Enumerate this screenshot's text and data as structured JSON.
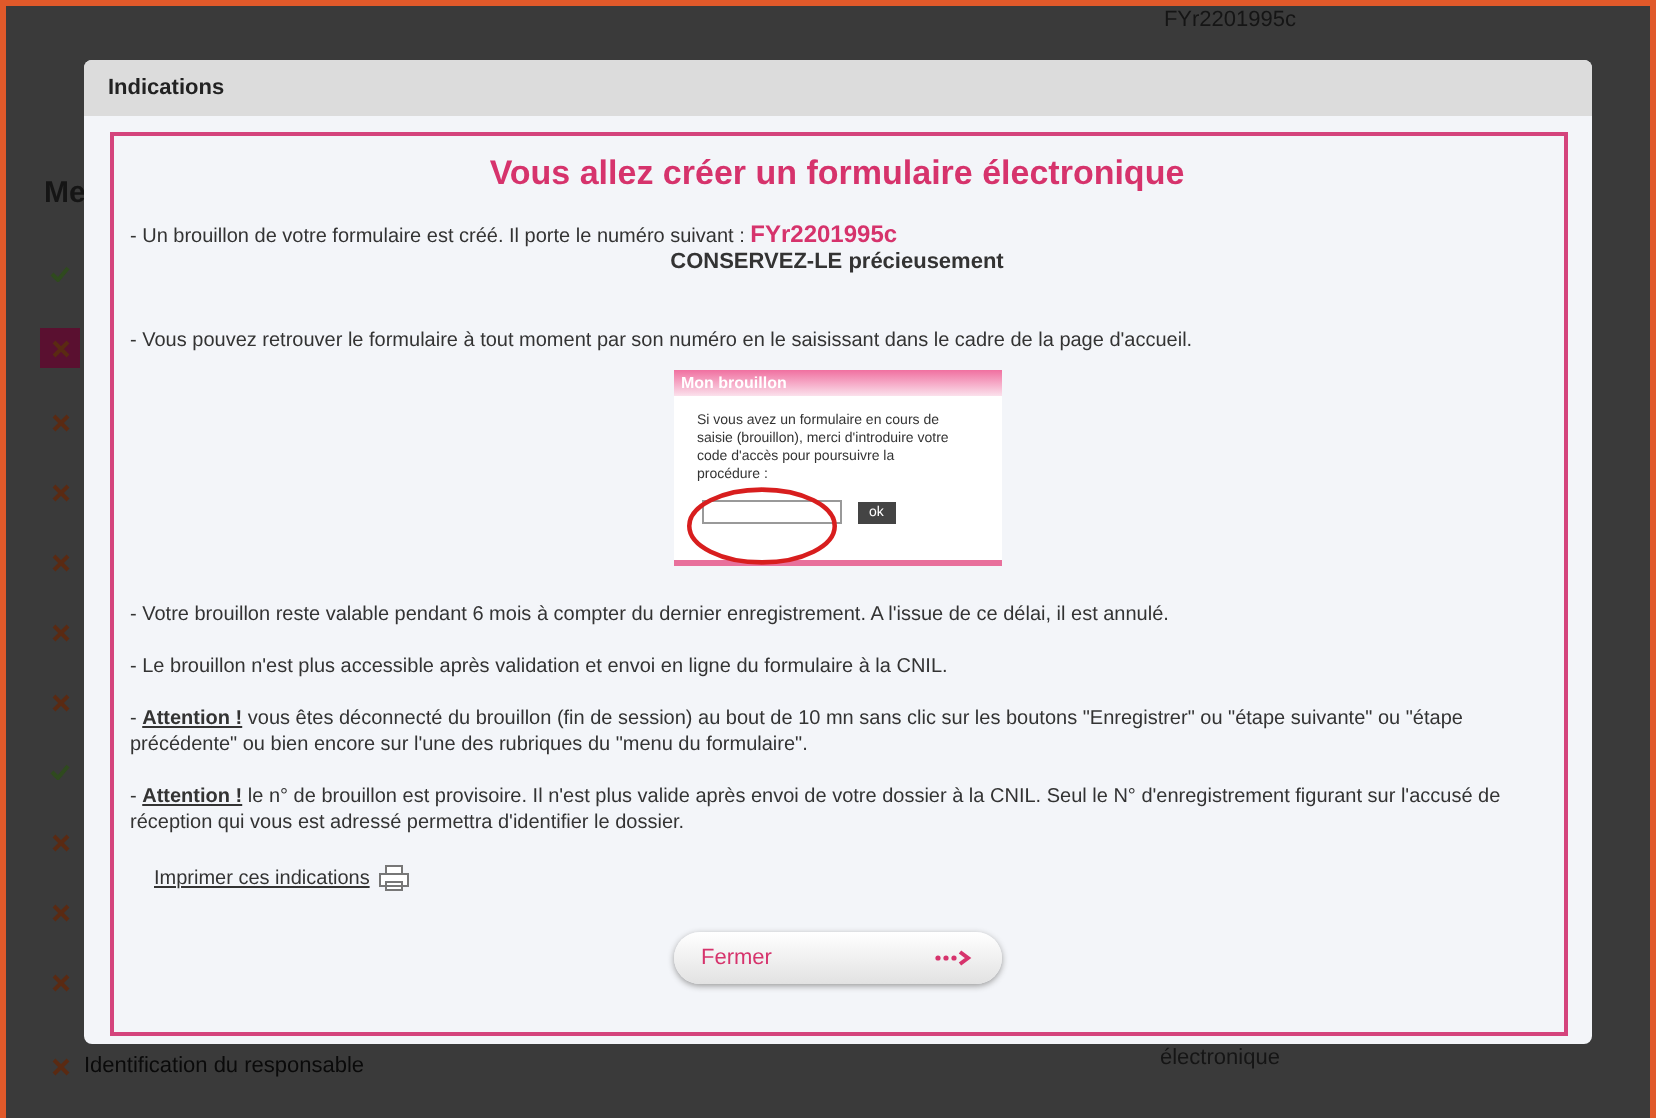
{
  "background": {
    "reference": "FYr2201995c",
    "heading": "Me",
    "steps": [
      {
        "complete": true,
        "selected": false
      },
      {
        "complete": false,
        "selected": true
      },
      {
        "complete": false,
        "selected": false
      },
      {
        "complete": false,
        "selected": false
      },
      {
        "complete": false,
        "selected": false
      },
      {
        "complete": false,
        "selected": false
      },
      {
        "complete": false,
        "selected": false
      },
      {
        "complete": true,
        "selected": false
      },
      {
        "complete": false,
        "selected": false
      },
      {
        "complete": false,
        "selected": false
      },
      {
        "complete": false,
        "selected": false
      }
    ],
    "last_step": {
      "complete": false,
      "label": "Identification du responsable"
    },
    "field_label": "électronique"
  },
  "dialog": {
    "title": "Indications",
    "heading": "Vous allez créer un formulaire électronique",
    "intro": "- Un brouillon de votre formulaire est créé. Il porte le numéro suivant : **FYr2201995c**",
    "keep_note": "CONSERVEZ-LE précieusement",
    "find_note": "- Vous pouvez retrouver le formulaire à tout moment par son numéro en le saisissant dans le cadre de la page d'accueil.",
    "example": {
      "title": "Mon brouillon",
      "text": "Si vous avez un formulaire en cours de saisie (brouillon), merci d'introduire votre code d'accès pour poursuivre la procédure :",
      "button": "ok"
    },
    "notes": [
      {
        "kind": "plain",
        "text": "- Votre brouillon reste valable pendant 6 mois à compter du dernier enregistrement. A l'issue de ce délai, il est annulé."
      },
      {
        "kind": "plain",
        "text": "- Le brouillon n'est plus accessible après validation et envoi en ligne du formulaire à la CNIL."
      },
      {
        "kind": "warning",
        "text": "- **Attention !** vous êtes déconnecté du brouillon (fin de session) au bout de 10 mn sans clic sur les boutons \"Enregistrer\" ou \"étape suivante\" ou \"étape précédente\" ou bien encore sur l'une des rubriques du \"menu du formulaire\"."
      },
      {
        "kind": "warning",
        "text": "- **Attention !** le n° de brouillon est provisoire. Il n'est plus valide après envoi de votre dossier à la CNIL. Seul le N° d'enregistrement figurant sur l'accusé de réception qui vous est adressé permettra d'identifier le dossier."
      }
    ],
    "print_link": "Imprimer ces indications",
    "close_button": "Fermer"
  }
}
